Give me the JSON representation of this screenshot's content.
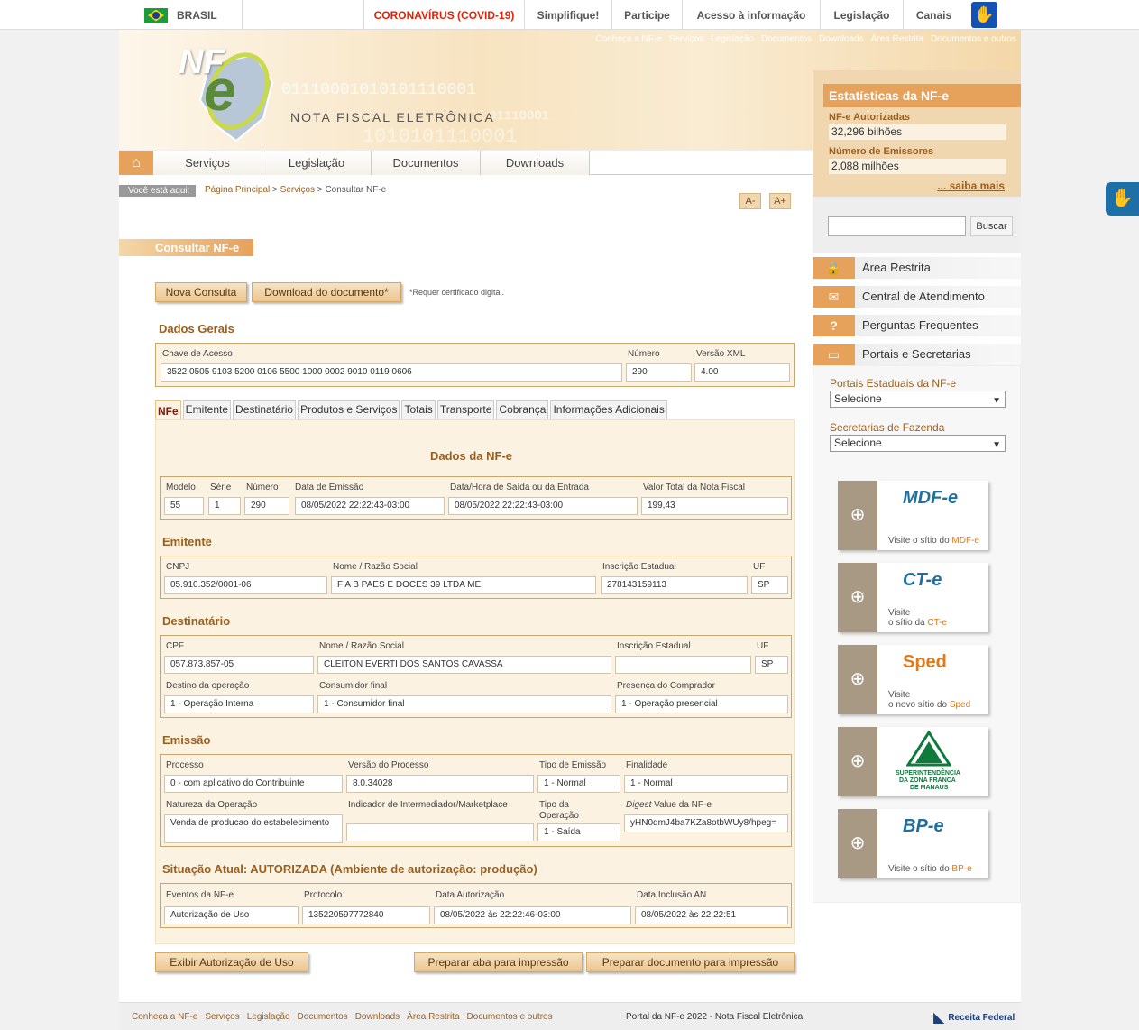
{
  "gov": {
    "brasil": "BRASIL",
    "covid": "CORONAVÍRUS (COVID-19)",
    "menu": [
      "Simplifique!",
      "Participe",
      "Acesso à informação",
      "Legislação",
      "Canais"
    ]
  },
  "top_links": [
    "Conheça a NF-e",
    "Serviços",
    "Legislação",
    "Documentos",
    "Downloads",
    "Área Restrita",
    "Documentos e outros"
  ],
  "logo": {
    "nf": "NF",
    "e": "e",
    "title": "NOTA FISCAL ELETRÔNICA",
    "bits1": "01110001010101110001",
    "bits2": "01110001",
    "bits3": "1010101110001"
  },
  "nav": [
    "Serviços",
    "Legislação",
    "Documentos",
    "Downloads"
  ],
  "breadcrumb": {
    "label": "Você está aqui:",
    "home": "Página Principal",
    "sep1": " > ",
    "services": "Serviços",
    "sep2": " > ",
    "current": "Consultar NF-e"
  },
  "font_buttons": {
    "decrease": "A-",
    "increase": "A+"
  },
  "section_title": "Consultar NF-e",
  "buttons": {
    "new_query": "Nova Consulta",
    "download": "Download do documento*",
    "note": "*Requer certificado digital.",
    "exibir": "Exibir Autorização de Uso",
    "print_tab": "Preparar aba para impressão",
    "print_doc": "Preparar documento para impressão"
  },
  "dados_gerais": {
    "title": "Dados Gerais",
    "chave_label": "Chave de Acesso",
    "chave": "3522 0505 9103 5200 0106 5500 1000 0002 9010 0119 0606",
    "numero_label": "Número",
    "numero": "290",
    "versao_label": "Versão XML",
    "versao": "4.00"
  },
  "tabs": [
    "NFe",
    "Emitente",
    "Destinatário",
    "Produtos e Serviços",
    "Totais",
    "Transporte",
    "Cobrança",
    "Informações Adicionais"
  ],
  "nfe": {
    "title": "Dados da NF-e",
    "labels": [
      "Modelo",
      "Série",
      "Número",
      "Data de Emissão",
      "Data/Hora de Saída ou da Entrada",
      "Valor Total da Nota Fiscal"
    ],
    "values": [
      "55",
      "1",
      "290",
      "08/05/2022 22:22:43-03:00",
      "08/05/2022 22:22:43-03:00",
      "199,43"
    ]
  },
  "emitente": {
    "title": "Emitente",
    "labels": [
      "CNPJ",
      "Nome / Razão Social",
      "Inscrição Estadual",
      "UF"
    ],
    "values": [
      "05.910.352/0001-06",
      "F A B PAES E DOCES 39 LTDA ME",
      "278143159113",
      "SP"
    ]
  },
  "destinatario": {
    "title": "Destinatário",
    "labels": [
      "CPF",
      "Nome / Razão Social",
      "Inscrição Estadual",
      "UF"
    ],
    "values": [
      "057.873.857-05",
      "CLEITON EVERTI DOS SANTOS CAVASSA",
      "",
      "SP"
    ],
    "labels2": [
      "Destino da operação",
      "Consumidor final",
      "Presença do Comprador"
    ],
    "values2": [
      "1 - Operação Interna",
      "1 - Consumidor final",
      "1 - Operação presencial"
    ]
  },
  "emissao": {
    "title": "Emissão",
    "labels": [
      "Processo",
      "Versão do Processo",
      "Tipo de Emissão",
      "Finalidade"
    ],
    "values": [
      "0 - com aplicativo do Contribuinte",
      "8.0.34028",
      "1 - Normal",
      "1 - Normal"
    ],
    "labels2": [
      "Natureza da Operação",
      "Indicador de Intermediador/Marketplace",
      "Tipo da Operação",
      "Digest",
      "Value da NF-e"
    ],
    "values2": [
      "Venda de producao do estabelecimento",
      "",
      "1 - Saída",
      "yHN0dmJ4ba7KZa8otbWUy8/hpeg="
    ]
  },
  "situacao": {
    "title": "Situação Atual: AUTORIZADA (Ambiente de autorização: produção)",
    "labels": [
      "Eventos da NF-e",
      "Protocolo",
      "Data Autorização",
      "Data Inclusão AN"
    ],
    "values": [
      "Autorização de Uso",
      "135220597772840",
      "08/05/2022 às 22:22:46-03:00",
      "08/05/2022 às 22:22:51"
    ]
  },
  "stats": {
    "title": "Estatísticas da NF-e",
    "auth_label": "NF-e Autorizadas",
    "auth": "32,296 bilhões",
    "emis_label": "Número de Emissores",
    "emis": "2,088 milhões",
    "more": "... saiba mais"
  },
  "search": {
    "button": "Buscar"
  },
  "sidebar": [
    "Área Restrita",
    "Central de Atendimento",
    "Perguntas Frequentes",
    "Portais e Secretarias"
  ],
  "selects": {
    "portais": "Portais Estaduais da NF-e",
    "secretarias": "Secretarias de Fazenda",
    "option": "Selecione"
  },
  "banners": [
    {
      "logo": "MDF-e",
      "text1": "Visite o sítio do ",
      "brand": "MDF-e"
    },
    {
      "logo": "CT-e",
      "text1": "Visite",
      "text2": "o sítio da ",
      "brand": "CT-e"
    },
    {
      "logo": "Sped",
      "text1": "Visite",
      "text2": "o novo sítio do ",
      "brand": "Sped"
    },
    {
      "logo": "SUFRAMA",
      "text1": "SUPERINTENDÊNCIA",
      "text2": "DA ZONA FRANCA",
      "text3": "DE MANAUS"
    },
    {
      "logo": "BP-e",
      "text1": "Visite o sítio do ",
      "brand": "BP-e"
    }
  ],
  "footer": {
    "links": [
      "Conheça a NF-e",
      "Serviços",
      "Legislação",
      "Documentos",
      "Downloads",
      "Área Restrita",
      "Documentos e outros"
    ],
    "copy": "Portal da NF-e 2022 - Nota Fiscal Eletrônica",
    "rf": "Receita Federal"
  }
}
